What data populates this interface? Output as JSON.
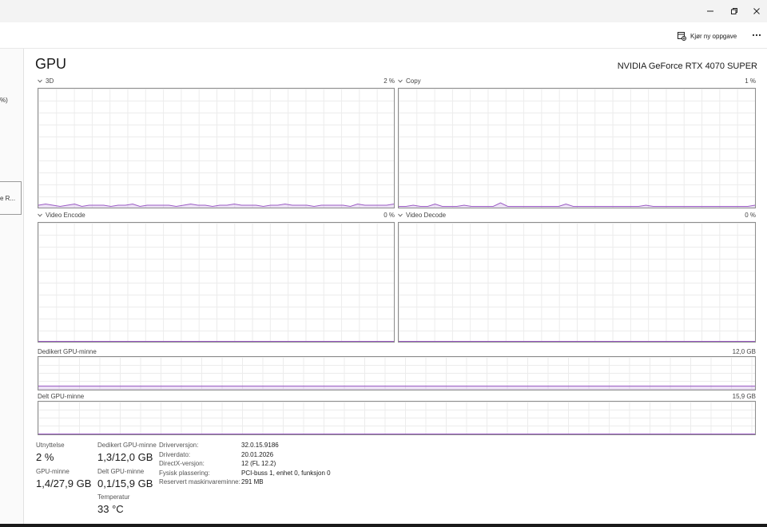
{
  "window": {
    "minimize_icon": "minimize-icon",
    "restore_icon": "restore-icon",
    "close_icon": "close-icon"
  },
  "toolbar": {
    "run_task_label": "Kjør ny oppgave",
    "more_icon": "more-icon"
  },
  "sidebar": {
    "fragment_1": "%)",
    "fragment_2": "e R..."
  },
  "header": {
    "title": "GPU",
    "gpu_name": "NVIDIA GeForce RTX 4070 SUPER"
  },
  "graphs": {
    "g3d": {
      "label": "3D",
      "value": "2 %"
    },
    "copy": {
      "label": "Copy",
      "value": "1 %"
    },
    "encode": {
      "label": "Video Encode",
      "value": "0 %"
    },
    "decode": {
      "label": "Video Decode",
      "value": "0 %"
    },
    "dedicated": {
      "label": "Dedikert GPU-minne",
      "max": "12,0 GB"
    },
    "shared": {
      "label": "Delt GPU-minne",
      "max": "15,9 GB"
    }
  },
  "stats": {
    "utilization": {
      "label": "Utnyttelse",
      "value": "2 %"
    },
    "dedicated_mem": {
      "label": "Dedikert GPU-minne",
      "value": "1,3/12,0 GB"
    },
    "gpu_mem": {
      "label": "GPU-minne",
      "value": "1,4/27,9 GB"
    },
    "shared_mem": {
      "label": "Delt GPU-minne",
      "value": "0,1/15,9 GB"
    },
    "temperature": {
      "label": "Temperatur",
      "value": "33 °C"
    }
  },
  "info": [
    {
      "key": "Driverversjon:",
      "value": "32.0.15.9186"
    },
    {
      "key": "Driverdato:",
      "value": "20.01.2026"
    },
    {
      "key": "DirectX-versjon:",
      "value": "12 (FL 12.2)"
    },
    {
      "key": "Fysisk plassering:",
      "value": "PCI-buss 1, enhet 0, funksjon 0"
    },
    {
      "key": "Reservert maskinvareminne:",
      "value": "291 MB"
    }
  ],
  "chart_data": [
    {
      "type": "area",
      "title": "3D",
      "ylim": [
        0,
        100
      ],
      "series": [
        {
          "values": [
            2,
            3,
            2,
            1,
            2,
            3,
            1,
            2,
            2,
            2,
            1,
            2,
            2,
            3,
            1,
            2,
            2,
            2,
            2,
            1,
            2,
            3,
            2,
            2,
            1,
            2,
            2,
            3,
            2,
            2,
            2,
            1,
            2,
            2,
            3,
            2,
            2,
            2,
            1,
            2,
            2,
            2,
            2,
            1,
            3,
            2,
            2,
            2,
            2,
            3
          ]
        }
      ]
    },
    {
      "type": "area",
      "title": "Copy",
      "ylim": [
        0,
        100
      ],
      "series": [
        {
          "values": [
            1,
            1,
            2,
            1,
            1,
            3,
            1,
            1,
            1,
            2,
            1,
            1,
            1,
            1,
            4,
            1,
            1,
            1,
            1,
            1,
            1,
            1,
            1,
            3,
            1,
            1,
            1,
            1,
            1,
            1,
            1,
            1,
            1,
            1,
            2,
            1,
            1,
            1,
            1,
            1,
            1,
            1,
            1,
            1,
            1,
            1,
            1,
            1,
            1,
            2
          ]
        }
      ]
    },
    {
      "type": "area",
      "title": "Video Encode",
      "ylim": [
        0,
        100
      ],
      "series": [
        {
          "values": [
            0,
            0,
            0,
            0,
            0,
            0,
            0,
            0,
            0,
            0,
            0,
            0,
            0,
            0,
            0,
            0,
            0,
            0,
            0,
            0
          ]
        }
      ]
    },
    {
      "type": "area",
      "title": "Video Decode",
      "ylim": [
        0,
        100
      ],
      "series": [
        {
          "values": [
            0,
            0,
            0,
            0,
            0,
            0,
            0,
            0,
            0,
            0,
            0,
            0,
            0,
            0,
            0,
            0,
            0,
            0,
            0,
            0
          ]
        }
      ]
    },
    {
      "type": "area",
      "title": "Dedikert GPU-minne",
      "ylim": [
        0,
        12.0
      ],
      "series": [
        {
          "values": [
            1.3,
            1.3,
            1.3,
            1.3,
            1.3,
            1.3,
            1.3,
            1.3,
            1.3,
            1.3,
            1.3,
            1.3,
            1.3,
            1.3,
            1.3,
            1.3,
            1.3,
            1.3,
            1.3,
            1.3,
            1.3,
            1.3,
            1.3,
            1.3,
            1.3,
            1.3,
            1.3,
            1.3,
            1.3,
            1.3
          ]
        }
      ]
    },
    {
      "type": "area",
      "title": "Delt GPU-minne",
      "ylim": [
        0,
        15.9
      ],
      "series": [
        {
          "values": [
            0.1,
            0.1,
            0.1,
            0.1,
            0.1,
            0.1,
            0.1,
            0.1,
            0.1,
            0.1,
            0.1,
            0.1,
            0.1,
            0.1,
            0.1,
            0.1,
            0.1,
            0.1,
            0.1,
            0.1
          ]
        }
      ]
    }
  ]
}
